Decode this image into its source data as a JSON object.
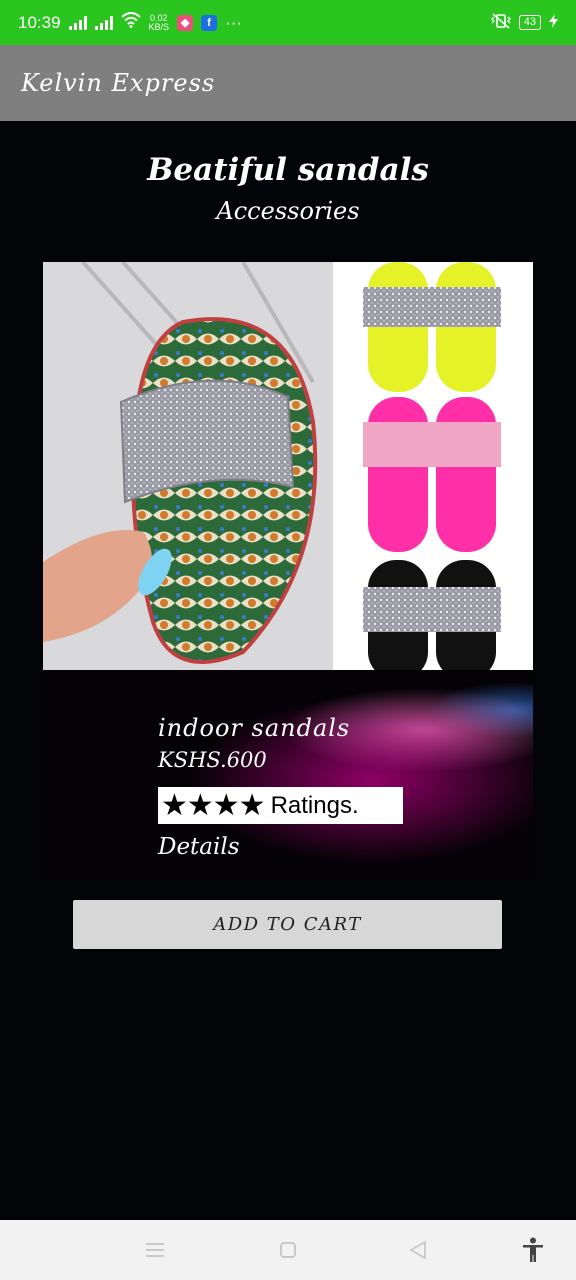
{
  "status_bar": {
    "time": "10:39",
    "net_speed_value": "0.02",
    "net_speed_unit": "KB/S",
    "battery": "43",
    "icons": [
      "signal-icon",
      "signal-icon",
      "wifi-icon",
      "app-notification-icon",
      "facebook-icon",
      "more-icon",
      "vibrate-icon",
      "battery-icon",
      "charging-icon"
    ]
  },
  "app_bar": {
    "title": "Kelvin Express"
  },
  "product": {
    "headline": "Beatiful sandals",
    "category": "Accessories",
    "name": "indoor sandals",
    "price": "KSHS.600",
    "stars": "★★★★",
    "rating_count": 4,
    "rating_label": "Ratings.",
    "details_label": "Details",
    "add_to_cart_label": "ADD TO CART"
  },
  "nav_bar": {
    "icons": [
      "menu-icon",
      "home-icon",
      "back-icon",
      "accessibility-icon"
    ]
  },
  "colors": {
    "status_bar": "#2bc51f",
    "app_bar": "#7f7f7f",
    "background": "#020408",
    "button": "#d7d7d7",
    "nav_bar": "#f2f2f2"
  }
}
